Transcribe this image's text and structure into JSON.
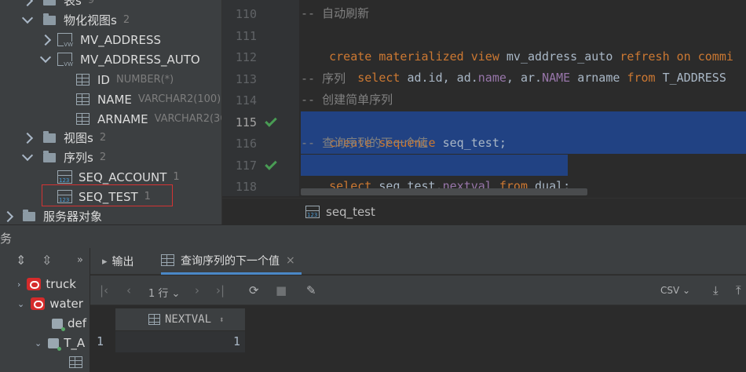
{
  "tree": {
    "row0_label": "表s",
    "row0_count": "9",
    "matviews_label": "物化视图s",
    "matviews_count": "2",
    "mv1": "MV_ADDRESS",
    "mv2": "MV_ADDRESS_AUTO",
    "cols": [
      {
        "name": "ID",
        "type": "NUMBER(*)"
      },
      {
        "name": "NAME",
        "type": "VARCHAR2(100)"
      },
      {
        "name": "ARNAME",
        "type": "VARCHAR2(30"
      }
    ],
    "views_label": "视图s",
    "views_count": "2",
    "seqs_label": "序列s",
    "seqs_count": "2",
    "seq1": "SEQ_ACCOUNT",
    "seq1_count": "1",
    "seq2": "SEQ_TEST",
    "seq2_count": "1",
    "server_objects": "服务器对象"
  },
  "editor": {
    "lines": [
      "110",
      "111",
      "112",
      "113",
      "114",
      "115",
      "116",
      "117",
      "118"
    ],
    "l110": "-- 自动刷新",
    "l111_kw1": "create materialized view",
    "l111_id": " mv_address_auto ",
    "l111_kw2": "refresh on commi",
    "l112_kw1": "    select ",
    "l112_a": "ad.id, ad.",
    "l112_f1": "name",
    "l112_b": ", ar.",
    "l112_f2": "NAME",
    "l112_c": " arname ",
    "l112_kw2": "from",
    "l112_d": " T_ADDRESS",
    "l113": "-- 序列",
    "l114": "-- 创建简单序列",
    "l115_kw": "create sequence",
    "l115_id": " seq_test;",
    "l116": "-- 查询序列的下一个值",
    "l117_kw1": "select",
    "l117_id": " seq_test.",
    "l117_fn": "nextval",
    "l117_kw2": " from",
    "l117_id2": " dual;",
    "breadcrumb": "seq_test"
  },
  "services": {
    "title": "务",
    "nodes": [
      "truck",
      "water",
      "def",
      "T_A"
    ]
  },
  "result": {
    "tab_output": "输出",
    "tab_query": "查询序列的下一个值",
    "rows_label": "1 行",
    "format": "CSV",
    "column": "NEXTVAL",
    "row_num": "1",
    "value": "1"
  },
  "colors": {
    "selection": "#214283",
    "keyword": "#cc7832",
    "comment": "#808080",
    "check": "#499c54",
    "highlight_box": "#d33434",
    "tab_accent": "#4a88c7"
  }
}
